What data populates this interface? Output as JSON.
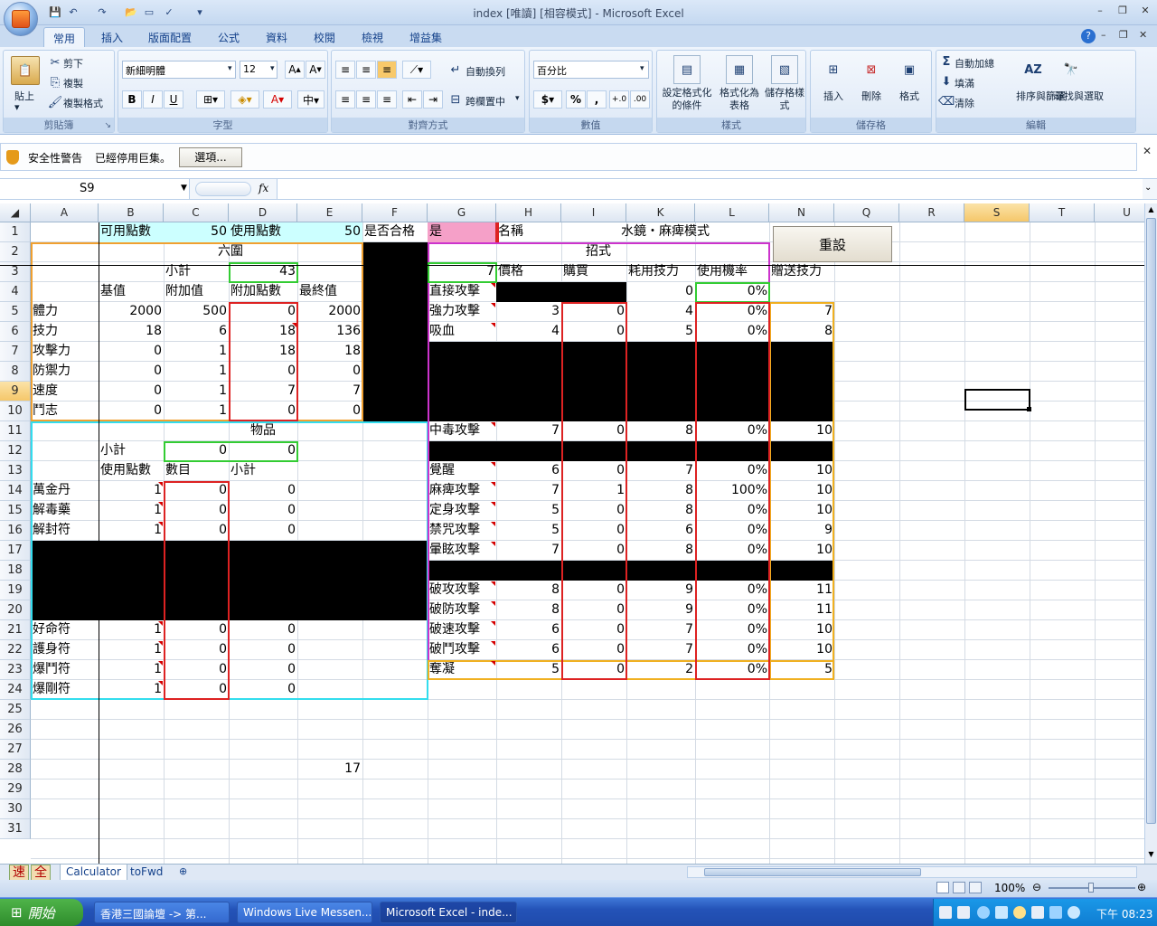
{
  "window": {
    "title": "index [唯讀] [相容模式] - Microsoft Excel",
    "minimize": "–",
    "restore": "❐",
    "close": "✕"
  },
  "ribbon": {
    "tabs": [
      "常用",
      "插入",
      "版面配置",
      "公式",
      "資料",
      "校閱",
      "檢視",
      "增益集"
    ],
    "clipboard": {
      "paste": "貼上",
      "cut": "剪下",
      "copy": "複製",
      "format_painter": "複製格式",
      "label": "剪貼簿"
    },
    "font": {
      "name": "新細明體",
      "size": "12",
      "bold": "B",
      "italic": "I",
      "underline": "U",
      "label": "字型"
    },
    "alignment": {
      "wrap": "自動換列",
      "merge": "跨欄置中",
      "label": "對齊方式"
    },
    "number": {
      "format": "百分比",
      "currency": "$",
      "percent": "%",
      "comma": ",",
      "label": "數值"
    },
    "styles": {
      "conditional": "設定格式化的條件",
      "table": "格式化為表格",
      "cell": "儲存格樣式",
      "label": "樣式"
    },
    "cells": {
      "insert": "插入",
      "delete": "刪除",
      "format": "格式",
      "label": "儲存格"
    },
    "editing": {
      "autosum": "自動加總",
      "fill": "填滿",
      "clear": "清除",
      "sort": "排序與篩選",
      "find": "尋找與選取",
      "label": "編輯"
    }
  },
  "security": {
    "title": "安全性警告",
    "message": "已經停用巨集。",
    "options": "選項..."
  },
  "formula": {
    "name_box": "S9",
    "fx": "fx",
    "value": ""
  },
  "columns": [
    "A",
    "B",
    "C",
    "D",
    "E",
    "F",
    "G",
    "H",
    "I",
    "K",
    "L",
    "N",
    "Q",
    "R",
    "S",
    "T",
    "U"
  ],
  "rows": [
    "1",
    "2",
    "3",
    "4",
    "5",
    "6",
    "7",
    "8",
    "9",
    "10",
    "11",
    "12",
    "13",
    "14",
    "15",
    "16",
    "17",
    "18",
    "19",
    "20",
    "21",
    "22",
    "23",
    "24",
    "25",
    "26",
    "27",
    "28",
    "29",
    "30",
    "31"
  ],
  "cells": {
    "B1": "可用點數",
    "C1": "50",
    "D1": "使用點數",
    "E1": "50",
    "F1": "是否合格",
    "G1": "是",
    "H1": "名稱",
    "J1": "水鏡・麻痺模式",
    "A2": "六圍",
    "G2": "招式",
    "C3": "小計",
    "D3": "43",
    "G3": "7",
    "H3": "價格",
    "I3": "購買",
    "K3": "耗用技力",
    "L3": "使用機率",
    "N3": "贈送技力",
    "B4": "基值",
    "C4": "附加值",
    "D4": "附加點數",
    "E4": "最終值",
    "G4": "直接攻擊",
    "K4": "0",
    "L4": "0%",
    "A5": "體力",
    "B5": "2000",
    "C5": "500",
    "D5": "0",
    "E5": "2000",
    "G5": "強力攻擊",
    "H5": "3",
    "I5": "0",
    "K5": "4",
    "L5": "0%",
    "N5": "7",
    "A6": "技力",
    "B6": "18",
    "C6": "6",
    "D6": "18",
    "E6": "136",
    "G6": "吸血",
    "H6": "4",
    "I6": "0",
    "K6": "5",
    "L6": "0%",
    "N6": "8",
    "A7": "攻擊力",
    "B7": "0",
    "C7": "1",
    "D7": "18",
    "E7": "18",
    "A8": "防禦力",
    "B8": "0",
    "C8": "1",
    "D8": "0",
    "E8": "0",
    "A9": "速度",
    "B9": "0",
    "C9": "1",
    "D9": "7",
    "E9": "7",
    "A10": "鬥志",
    "B10": "0",
    "C10": "1",
    "D10": "0",
    "E10": "0",
    "A11": "物品",
    "G11": "中毒攻擊",
    "H11": "7",
    "I11": "0",
    "K11": "8",
    "L11": "0%",
    "N11": "10",
    "B12": "小計",
    "C12": "0",
    "D12": "0",
    "B13": "使用點數",
    "C13": "數目",
    "D13": "小計",
    "G13": "覺醒",
    "H13": "6",
    "I13": "0",
    "K13": "7",
    "L13": "0%",
    "N13": "10",
    "A14": "萬金丹",
    "B14": "1",
    "C14": "0",
    "D14": "0",
    "G14": "麻痺攻擊",
    "H14": "7",
    "I14": "1",
    "K14": "8",
    "L14": "100%",
    "N14": "10",
    "A15": "解毒藥",
    "B15": "1",
    "C15": "0",
    "D15": "0",
    "G15": "定身攻擊",
    "H15": "5",
    "I15": "0",
    "K15": "8",
    "L15": "0%",
    "N15": "10",
    "A16": "解封符",
    "B16": "1",
    "C16": "0",
    "D16": "0",
    "G16": "禁咒攻擊",
    "H16": "5",
    "I16": "0",
    "K16": "6",
    "L16": "0%",
    "N16": "9",
    "G17": "暈眩攻擊",
    "H17": "7",
    "I17": "0",
    "K17": "8",
    "L17": "0%",
    "N17": "10",
    "G19": "破攻攻擊",
    "H19": "8",
    "I19": "0",
    "K19": "9",
    "L19": "0%",
    "N19": "11",
    "G20": "破防攻擊",
    "H20": "8",
    "I20": "0",
    "K20": "9",
    "L20": "0%",
    "N20": "11",
    "A21": "好命符",
    "B21": "1",
    "C21": "0",
    "D21": "0",
    "G21": "破速攻擊",
    "H21": "6",
    "I21": "0",
    "K21": "7",
    "L21": "0%",
    "N21": "10",
    "A22": "護身符",
    "B22": "1",
    "C22": "0",
    "D22": "0",
    "G22": "破鬥攻擊",
    "H22": "6",
    "I22": "0",
    "K22": "7",
    "L22": "0%",
    "N22": "10",
    "A23": "爆鬥符",
    "B23": "1",
    "C23": "0",
    "D23": "0",
    "G23": "奪凝",
    "H23": "5",
    "I23": "0",
    "K23": "2",
    "L23": "0%",
    "N23": "5",
    "A24": "爆剛符",
    "B24": "1",
    "C24": "0",
    "D24": "0",
    "E28": "17"
  },
  "reset_button": "重設",
  "sheets": {
    "tab1": "Calculator",
    "tab2": "toFwd",
    "ime1": "速",
    "ime2": "全"
  },
  "status": {
    "zoom": "100%"
  },
  "taskbar": {
    "start": "開始",
    "tasks": [
      "香港三國論壇 -> 第...",
      "Windows Live Messen...",
      "Microsoft Excel - inde..."
    ],
    "clock": "下午 08:23"
  }
}
